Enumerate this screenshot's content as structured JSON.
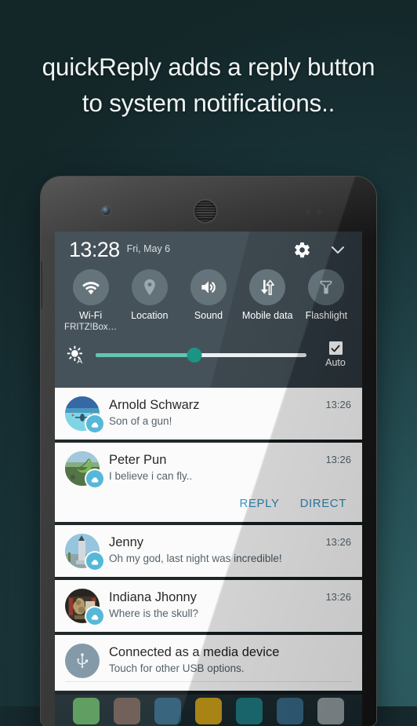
{
  "headline": "quickReply adds a reply button\nto system notifications..",
  "theme": {
    "background_dark": "#15282b",
    "background_light": "#2f6065",
    "accent_action": "#2f8fc0",
    "slider_fill": "#56c3ac",
    "slider_thumb": "#0d8f7d",
    "badge": "#4cb4d6",
    "qs_panel": "#3b4850",
    "tile_circle": "#5c6c72"
  },
  "statusbar": {
    "time": "13:28",
    "date": "Fri, May 6",
    "settings_icon": "gear-icon",
    "collapse_icon": "chevron-down-icon"
  },
  "quick_settings": {
    "tiles": [
      {
        "icon": "wifi-icon",
        "label": "Wi-Fi",
        "sub": "FRITZ!Box…",
        "active": true
      },
      {
        "icon": "location-pin-icon",
        "label": "Location",
        "sub": "",
        "active": false
      },
      {
        "icon": "sound-speaker-icon",
        "label": "Sound",
        "sub": "",
        "active": true
      },
      {
        "icon": "mobile-data-icon",
        "label": "Mobile\ndata",
        "sub": "",
        "active": true
      },
      {
        "icon": "flashlight-icon",
        "label": "Flashlight",
        "sub": "",
        "active": false
      }
    ],
    "brightness": {
      "icon": "auto-brightness-icon",
      "value_percent": 47,
      "auto_label": "Auto",
      "auto_checked": true,
      "checkbox_icon": "checkmark-icon"
    },
    "hidden_row_left": "",
    "hidden_row_right": ""
  },
  "notifications": [
    {
      "id": "arnold",
      "avatar": "beach-photo-avatar",
      "badge_icon": "cloud-drop-icon",
      "title": "Arnold Schwarz",
      "body": "Son of a gun!",
      "time": "13:26",
      "actions": []
    },
    {
      "id": "peter",
      "avatar": "leaf-photo-avatar",
      "badge_icon": "cloud-drop-icon",
      "title": "Peter Pun",
      "body": "I believe i can fly..",
      "time": "13:26",
      "actions": [
        "REPLY",
        "DIRECT"
      ]
    },
    {
      "id": "jenny",
      "avatar": "statue-photo-avatar",
      "badge_icon": "cloud-drop-icon",
      "title": "Jenny",
      "body": "Oh my god, last night was incredible!",
      "time": "13:26",
      "actions": []
    },
    {
      "id": "indiana",
      "avatar": "ruins-photo-avatar",
      "badge_icon": "cloud-drop-icon",
      "title": "Indiana Jhonny",
      "body": "Where is the skull?",
      "time": "13:26",
      "actions": []
    },
    {
      "id": "usb",
      "avatar": "usb-icon",
      "badge_icon": "",
      "title": "Connected as a media device",
      "body": "Touch for other USB options.",
      "time": "",
      "actions": []
    }
  ]
}
